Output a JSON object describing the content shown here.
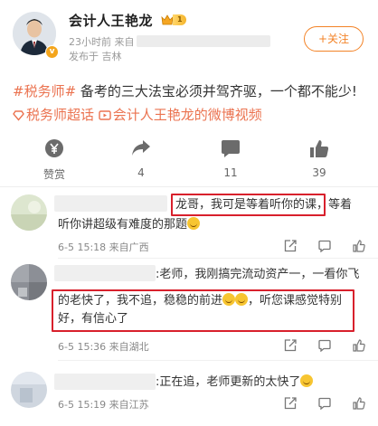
{
  "post": {
    "username": "会计人王艳龙",
    "vip_level": "1",
    "time": "23小时前",
    "source_prefix": "来自",
    "location": "发布于 吉林",
    "follow_label": "+关注",
    "body": {
      "hashtag1": "#税务师#",
      "text1": " 备考的三大法宝必须并驾齐驱，一个都不能少!",
      "link1": "税务师超话",
      "link2": "会计人王艳龙的微博视频"
    }
  },
  "actions": [
    {
      "icon": "reward-icon",
      "label": "赞赏"
    },
    {
      "icon": "share-icon",
      "label": "4"
    },
    {
      "icon": "comment-icon",
      "label": "11"
    },
    {
      "icon": "like-icon",
      "label": "39"
    }
  ],
  "comments": [
    {
      "line1": "龙哥，我可是等着听你的课",
      "line1_tail": "，等着",
      "line2": "听你讲超级有难度的那题",
      "meta": "6-5 15:18 来自广西"
    },
    {
      "line1_tail": ":老师，我刚搞完流动资产一，一看你飞",
      "line2": "的老快了，我不追，稳稳的前进",
      "line2_tail": "，听您课感觉特别",
      "line3": "好，有信心了",
      "meta": "6-5 15:36 来自湖北"
    },
    {
      "line1_tail": ":正在追，老师更新的太快了",
      "meta": "6-5 15:19 来自江苏"
    }
  ],
  "colors": {
    "accent": "#eb7350",
    "follow": "#f38327",
    "highlight_box": "#d8202c"
  }
}
